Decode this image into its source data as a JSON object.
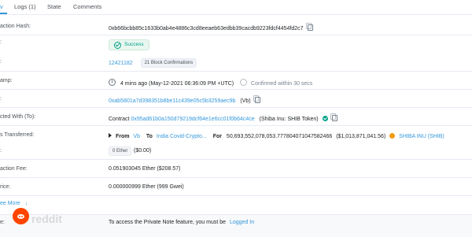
{
  "tabs": [
    {
      "label": "v",
      "active": true
    },
    {
      "label": "Logs (1)",
      "active": false
    },
    {
      "label": "State",
      "active": false
    },
    {
      "label": "Comments",
      "active": false
    }
  ],
  "rows": {
    "tx_hash": {
      "label": "action Hash:",
      "value": "0xb66bcbb85c1633b0ab4e4886c3cd8eeaeb63edbb39cacdb9223fdcf4454fd2c7"
    },
    "status": {
      "label": ":",
      "value": "Success"
    },
    "block": {
      "label": ":",
      "number": "12421182",
      "confirmations": "21 Block Confirmations"
    },
    "timestamp": {
      "label": "amp:",
      "value": "4 mins ago (May-12-2021 06:36:09 PM +UTC)",
      "confirmed": "Confirmed within 30 secs"
    },
    "from": {
      "label": ":",
      "address": "0xab5801a7d398351b8be11c439e05c5b3259aec9b",
      "tag": "(Vb)"
    },
    "interacted": {
      "label": "cted With (To):",
      "prefix": "Contract",
      "contract": "0x95ad61b0a150d79219dcf64e1e6cc01f0b64c4ce",
      "name": "(Shiba Inu: SHIB Token)"
    },
    "tokens": {
      "label": "s Transferred:",
      "from_label": "From",
      "from": "Vb",
      "to_label": "To",
      "to": "India Covid-Crypto...",
      "for_label": "For",
      "amount": "50,693,552,078,053.777804071047582466",
      "usd": "($1,013,871,041.56)",
      "token": "SHIBA INU (SHIB)"
    },
    "value": {
      "label": ":",
      "ether": "0 Ether",
      "usd": "($0.00)"
    },
    "fee": {
      "label": "action Fee:",
      "value": "0.051903045 Ether ($208.57)"
    },
    "gas_price": {
      "label": "rice:",
      "value": "0.000000999 Ether (999 Gwei)"
    }
  },
  "see_more": {
    "label": "ee More",
    "arrow": "↓"
  },
  "note": {
    "label": "e:",
    "text": "To access the Private Note feature, you must be",
    "link": "Logged In"
  },
  "watermark": {
    "wordmark": "reddit"
  },
  "colors": {
    "link": "#3498db",
    "success": "#00a186",
    "divider": "#e7eaf3",
    "reddit": "#ff4500"
  },
  "icons": [
    "copy-icon",
    "check-circle-icon",
    "clock-icon",
    "verified-check-icon",
    "arrow-right-icon",
    "shib-token-icon",
    "reddit-logo-icon"
  ]
}
